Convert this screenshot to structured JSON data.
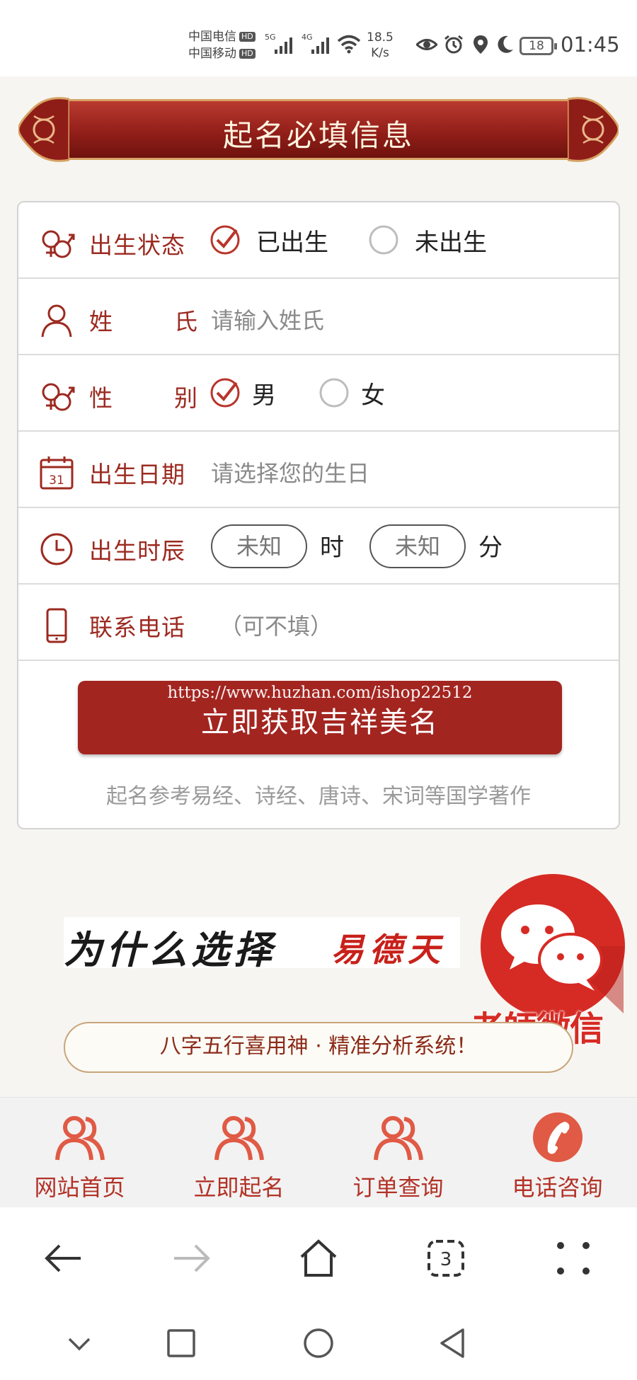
{
  "status_bar": {
    "carrier1": "中国电信",
    "carrier2": "中国移动",
    "hd": "HD",
    "net1": "5G",
    "net2": "4G",
    "speed_value": "18.5",
    "speed_unit": "K/s",
    "battery": "18",
    "time": "01:45"
  },
  "header": {
    "title": "起名必填信息"
  },
  "form": {
    "birth_status": {
      "label": "出生状态",
      "option_born": "已出生",
      "option_unborn": "未出生",
      "selected": "已出生"
    },
    "surname": {
      "label_chars": [
        "姓",
        "氏"
      ],
      "placeholder": "请输入姓氏"
    },
    "gender": {
      "label_chars": [
        "性",
        "别"
      ],
      "option_male": "男",
      "option_female": "女",
      "selected": "男"
    },
    "birth_date": {
      "label": "出生日期",
      "calendar_day": "31",
      "placeholder": "请选择您的生日"
    },
    "birth_time": {
      "label": "出生时辰",
      "hour_value": "未知",
      "hour_unit": "时",
      "minute_value": "未知",
      "minute_unit": "分"
    },
    "phone": {
      "label": "联系电话",
      "placeholder": "（可不填）"
    },
    "submit_label": "立即获取吉祥美名",
    "watermark": "https://www.huzhan.com/ishop22512",
    "footnote": "起名参考易经、诗经、唐诗、宋词等国学著作"
  },
  "promo": {
    "why_black": "为什么选择",
    "why_red": "易德天",
    "wechat_label": "老師微信",
    "bazi_banner": "八字五行喜用神 · 精准分析系统！"
  },
  "site_nav": {
    "items": [
      {
        "label": "网站首页",
        "icon": "users-icon"
      },
      {
        "label": "立即起名",
        "icon": "users-icon"
      },
      {
        "label": "订单查询",
        "icon": "users-icon"
      },
      {
        "label": "电话咨询",
        "icon": "phone-icon"
      }
    ]
  },
  "browser": {
    "tab_count": "3"
  },
  "colors": {
    "brand_red": "#a32520",
    "label_red": "#9c2a20",
    "nav_red": "#b33227",
    "gold": "#c9a47a"
  }
}
